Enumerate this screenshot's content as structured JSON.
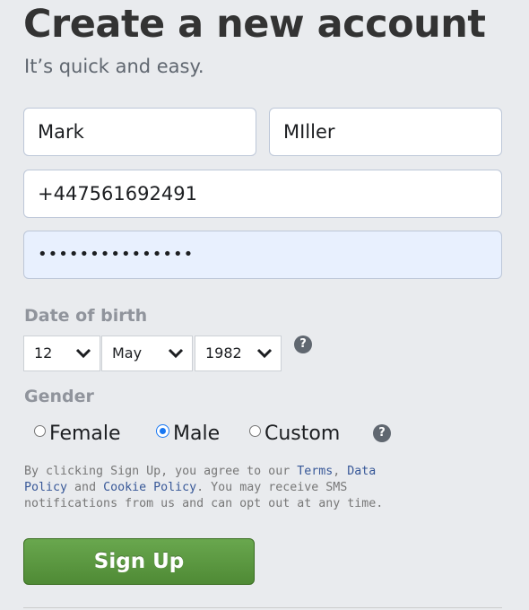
{
  "header": {
    "title": "Create a new account",
    "subtitle": "It’s quick and easy."
  },
  "form": {
    "first_name": "Mark",
    "last_name": "MIller",
    "phone": "+447561692491",
    "password_mask": "•••••••••••••••",
    "dob": {
      "label": "Date of birth",
      "day": "12",
      "month": "May",
      "year": "1982"
    },
    "gender": {
      "label": "Gender",
      "options": [
        "Female",
        "Male",
        "Custom"
      ],
      "selected": "Male"
    },
    "help_glyph": "?"
  },
  "terms": {
    "part1": "By clicking Sign Up, you agree to our ",
    "terms_link": "Terms",
    "comma": ", ",
    "data_policy_link": "Data Policy",
    "part2": " and ",
    "cookie_link": "Cookie Policy",
    "part3": ". You may receive SMS notifications from us and can opt out at any time."
  },
  "actions": {
    "signup_label": "Sign Up"
  },
  "colors": {
    "accent_green": "#5b9a3f",
    "link_blue": "#385898",
    "radio_blue": "#1877f2"
  }
}
